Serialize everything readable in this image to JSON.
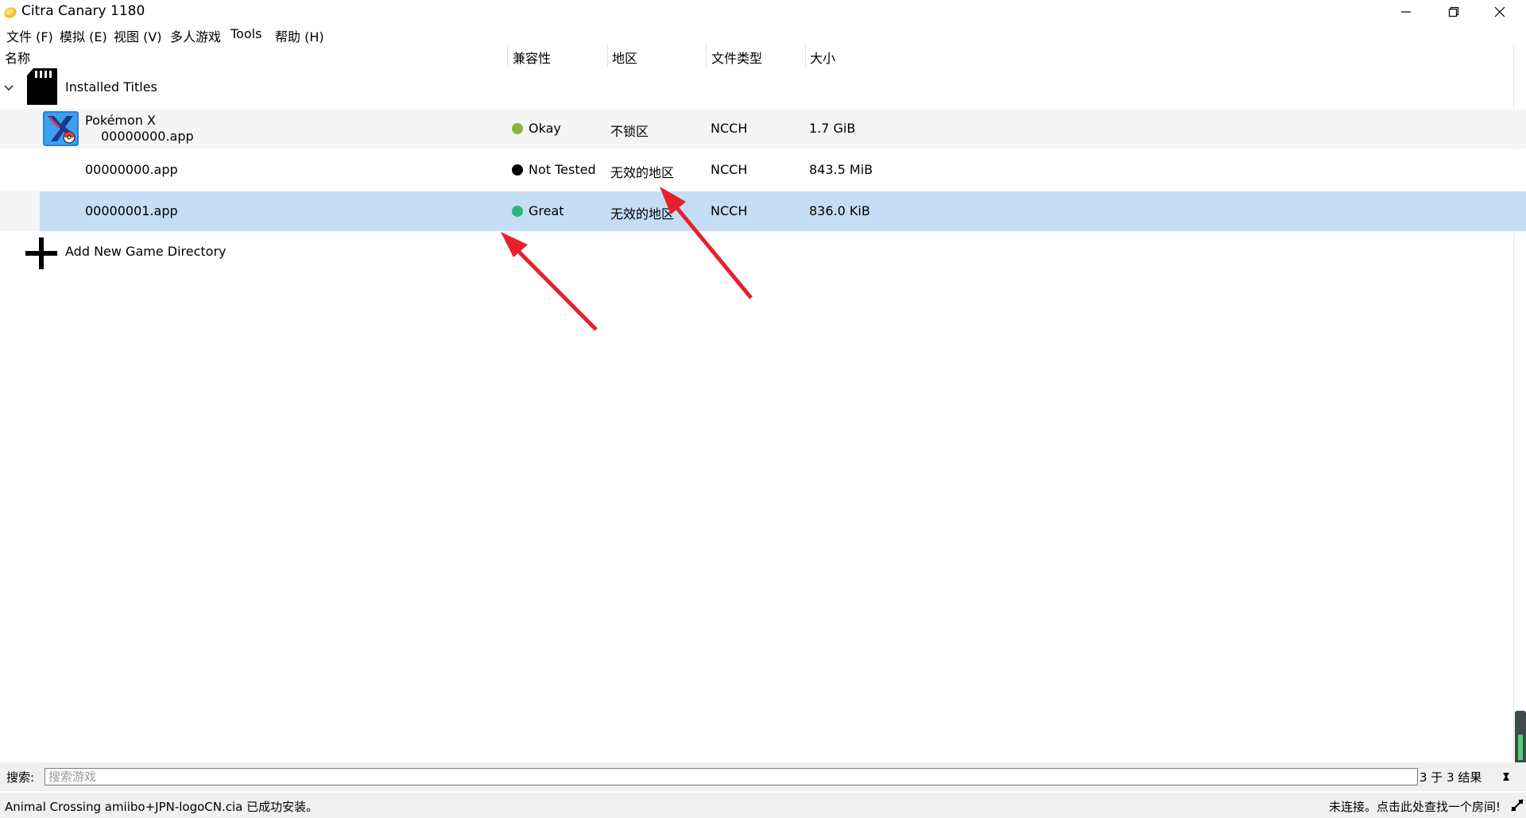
{
  "window": {
    "title": "Citra Canary 1180",
    "icon": "citra-lemon-icon",
    "controls": [
      "minimize-icon",
      "restore-icon",
      "close-icon"
    ]
  },
  "menu": [
    "文件 (F)",
    "模拟 (E)",
    "视图 (V)",
    "多人游戏",
    "Tools",
    "帮助 (H)"
  ],
  "columns": [
    "名称",
    "兼容性",
    "地区",
    "文件类型",
    "大小"
  ],
  "tree": {
    "group_label": "Installed Titles",
    "group_icon": "sd-card-icon",
    "expand_icon": "chevron-down-icon",
    "rows": [
      {
        "name": "Pokémon X",
        "subname": "00000000.app",
        "compat": "Okay",
        "compat_color": "#8db33a",
        "region": "不锁区",
        "type": "NCCH",
        "size": "1.7 GiB",
        "icon": "pokemon-x-icon"
      },
      {
        "name": "00000000.app",
        "compat": "Not Tested",
        "compat_color": "#000000",
        "region": "无效的地区",
        "type": "NCCH",
        "size": "843.5 MiB"
      },
      {
        "name": "00000001.app",
        "compat": "Great",
        "compat_color": "#2db37a",
        "region": "无效的地区",
        "type": "NCCH",
        "size": "836.0 KiB",
        "selected": true
      }
    ],
    "add_dir_label": "Add New Game Directory",
    "add_icon": "plus-icon"
  },
  "search": {
    "label": "搜索:",
    "placeholder": "搜索游戏",
    "result_text": "3 于 3 结果",
    "clear_icon": "clear-filter-icon"
  },
  "status": {
    "message": "Animal Crossing amiibo+JPN-logoCN.cia 已成功安装。",
    "network_text": "未连接。点击此处查找一个房间!",
    "network_icon": "disconnected-icon"
  },
  "colors": {
    "selection": "#c5ddf5",
    "alt_row": "#f5f5f5",
    "annotation_arrow": "#e8202a"
  }
}
